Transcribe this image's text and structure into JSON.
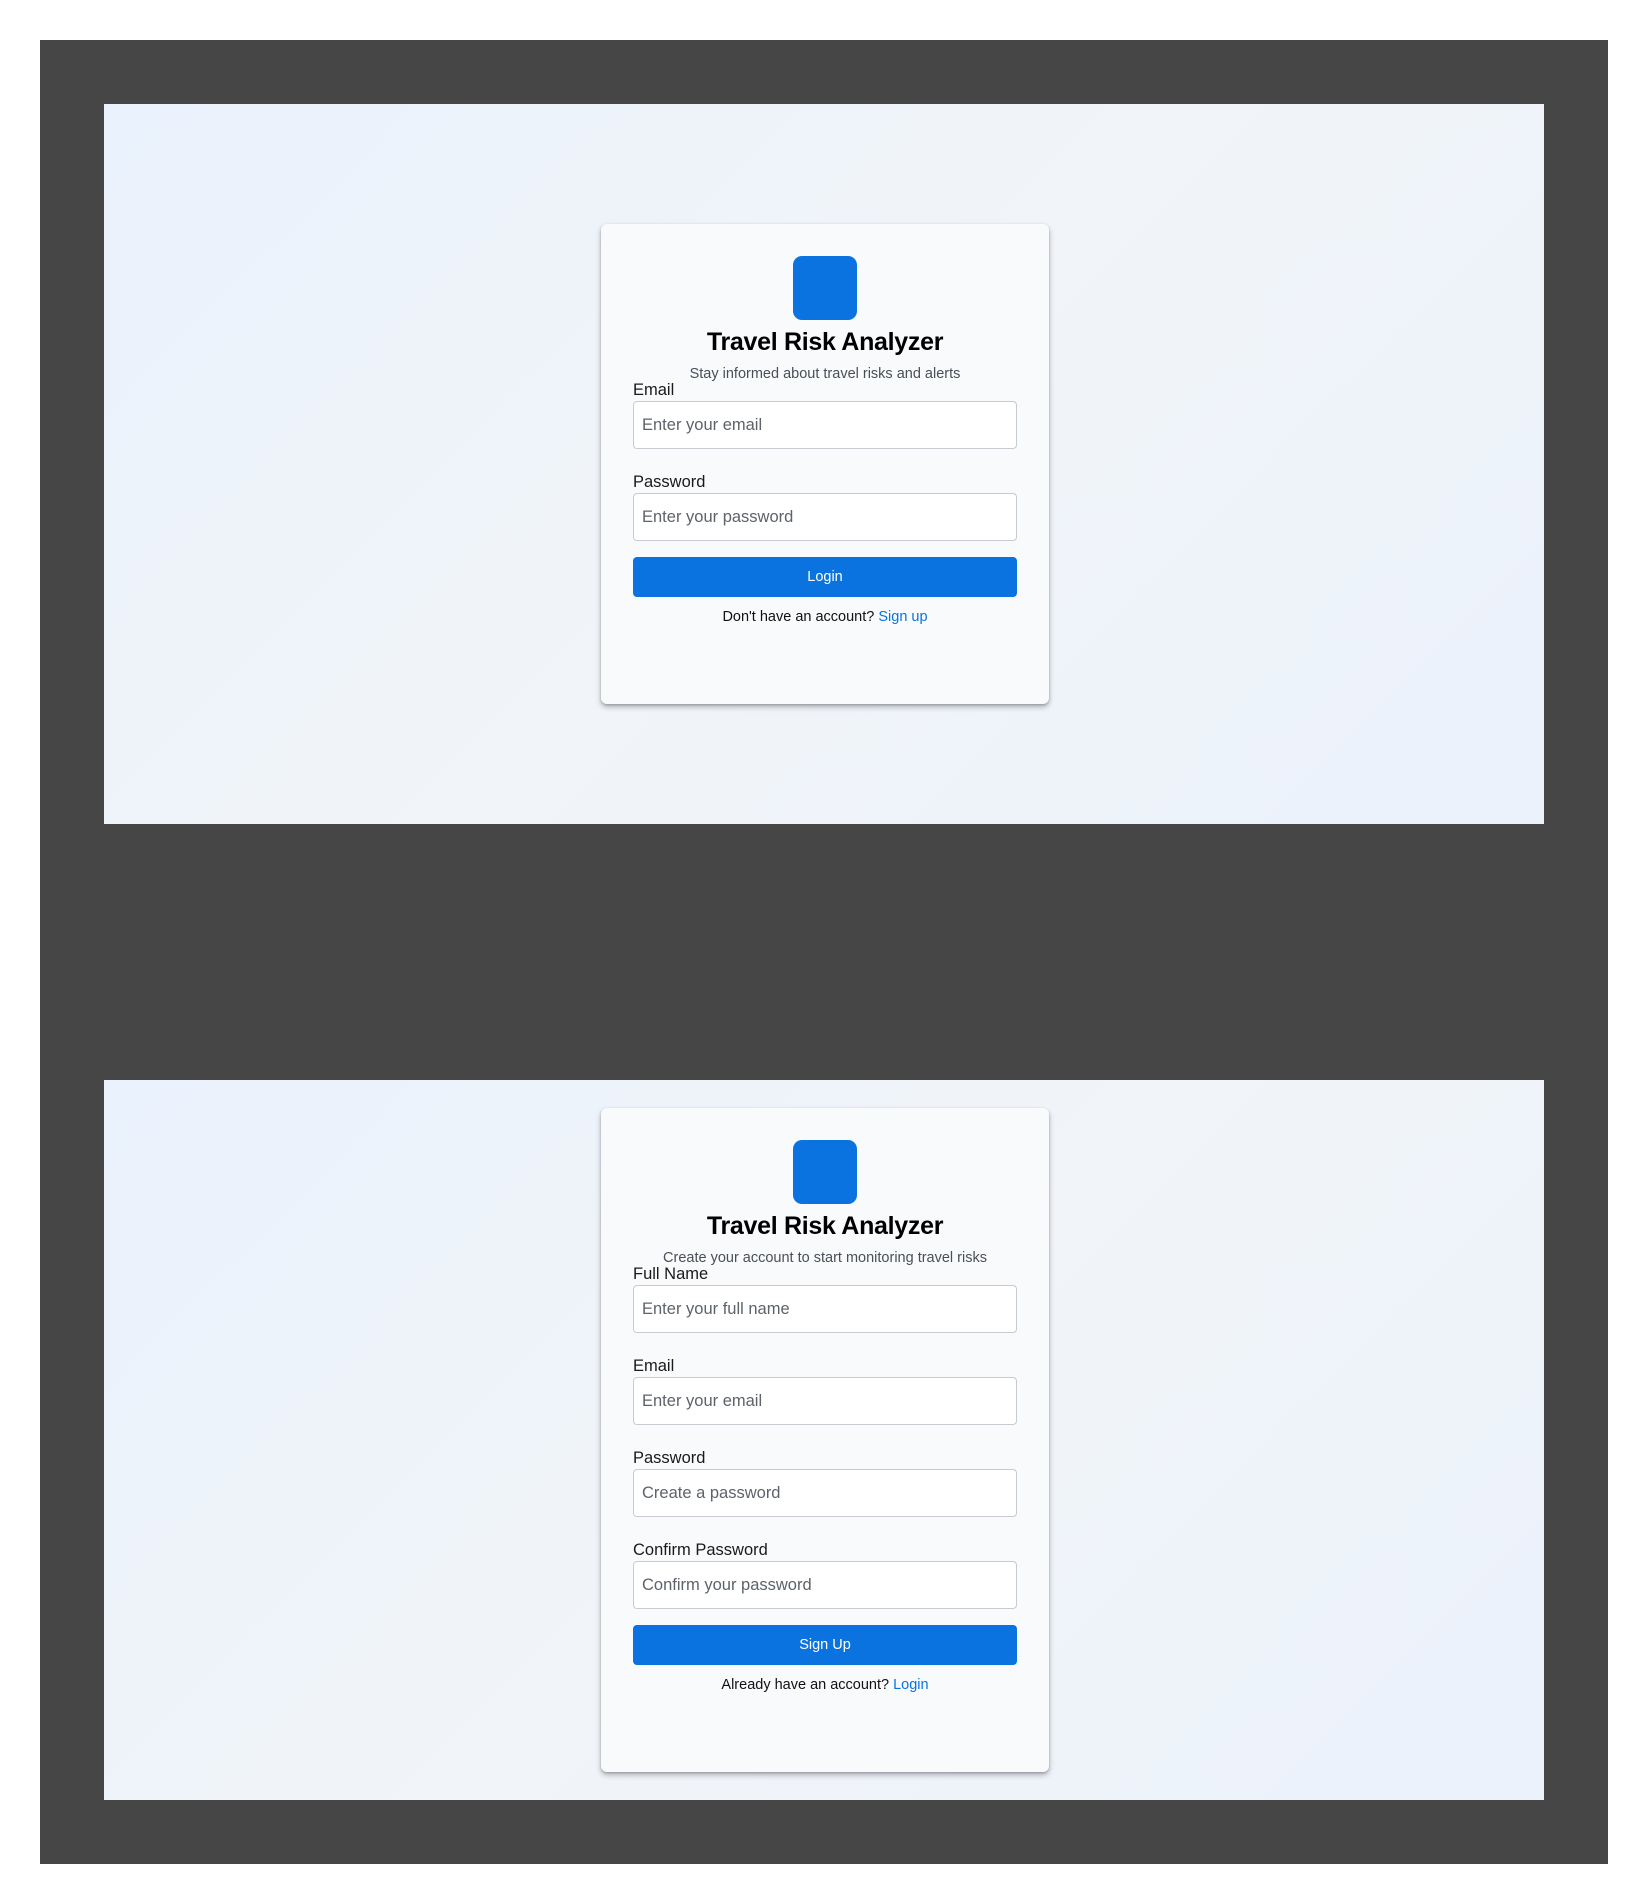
{
  "login": {
    "title": "Travel Risk Analyzer",
    "subtitle": "Stay informed about travel risks and alerts",
    "email": {
      "label": "Email",
      "placeholder": "Enter your email",
      "value": ""
    },
    "password": {
      "label": "Password",
      "placeholder": "Enter your password",
      "value": ""
    },
    "submit_label": "Login",
    "footer_text": "Don't have an account?",
    "footer_link": "Sign up"
  },
  "signup": {
    "title": "Travel Risk Analyzer",
    "subtitle": "Create your account to start monitoring travel risks",
    "full_name": {
      "label": "Full Name",
      "placeholder": "Enter your full name",
      "value": ""
    },
    "email": {
      "label": "Email",
      "placeholder": "Enter your email",
      "value": ""
    },
    "password": {
      "label": "Password",
      "placeholder": "Create a password",
      "value": ""
    },
    "confirm_password": {
      "label": "Confirm Password",
      "placeholder": "Confirm your password",
      "value": ""
    },
    "submit_label": "Sign Up",
    "footer_text": "Already have an account?",
    "footer_link": "Login"
  },
  "theme": {
    "accent": "#0a73e0",
    "board_background": "#464646",
    "card_background": "#f8fafc"
  }
}
